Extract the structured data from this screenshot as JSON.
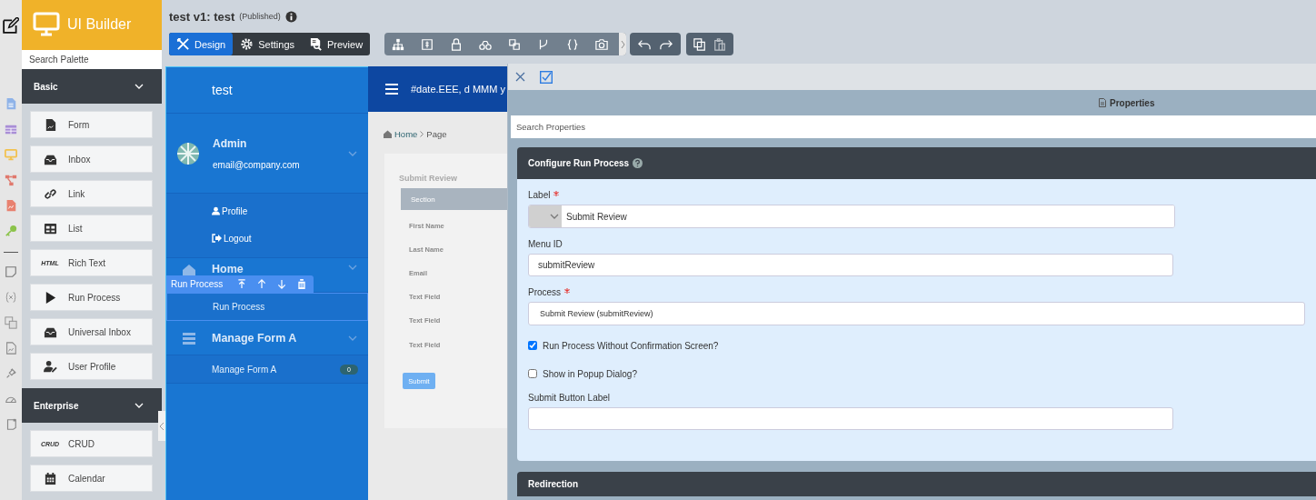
{
  "app": {
    "title": "UI Builder"
  },
  "palette": {
    "search_placeholder": "Search Palette",
    "groups": [
      {
        "name": "Basic",
        "expanded": true,
        "items": [
          {
            "label": "Form"
          },
          {
            "label": "Inbox"
          },
          {
            "label": "Link"
          },
          {
            "label": "List"
          },
          {
            "icon_text": "HTML",
            "label": "Rich Text"
          },
          {
            "label": "Run Process"
          },
          {
            "label": "Universal Inbox"
          },
          {
            "label": "User Profile"
          }
        ]
      },
      {
        "name": "Enterprise",
        "expanded": true,
        "items": [
          {
            "icon_text": "CRUD",
            "label": "CRUD"
          },
          {
            "label": "Calendar"
          }
        ]
      }
    ]
  },
  "header": {
    "title": "test v1: test",
    "status": "(Published)",
    "tabs": [
      {
        "label": "Design",
        "selected": true
      },
      {
        "label": "Settings",
        "selected": false
      },
      {
        "label": "Preview",
        "selected": false
      }
    ]
  },
  "preview": {
    "app_name": "test",
    "user": {
      "name": "Admin",
      "email": "email@company.com"
    },
    "user_links": [
      "Profile",
      "Logout"
    ],
    "menu": [
      {
        "label": "Home",
        "expanded": true,
        "children": [
          {
            "label": "Run Process",
            "selected": true
          }
        ]
      },
      {
        "label": "Manage Form A",
        "expanded": true,
        "children": [
          {
            "label": "Manage Form A",
            "selected": false,
            "badge": "0"
          }
        ]
      }
    ],
    "element_toolbar": {
      "label": "Run Process"
    },
    "topbar_text": "#date.EEE, d MMM y",
    "breadcrumb": [
      "Home",
      "Page"
    ],
    "form": {
      "title": "Submit Review",
      "section": "Section",
      "fields": [
        "First Name",
        "Last Name",
        "Email",
        "Text Field",
        "Text Field",
        "Text Field"
      ],
      "submit": "Submit"
    }
  },
  "properties": {
    "title": "Properties",
    "search_placeholder": "Search Properties",
    "section": "Configure Run Process",
    "fields": [
      {
        "kind": "select_text",
        "label": "Label",
        "required": true,
        "value": "Submit Review"
      },
      {
        "kind": "text",
        "label": "Menu ID",
        "required": false,
        "value": "submitReview"
      },
      {
        "kind": "select",
        "label": "Process",
        "required": true,
        "value": "Submit Review (submitReview)"
      },
      {
        "kind": "checkbox",
        "label": "Run Process Without Confirmation Screen?",
        "checked": true
      },
      {
        "kind": "checkbox",
        "label": "Show in Popup Dialog?",
        "checked": false
      },
      {
        "kind": "text",
        "label": "Submit Button Label",
        "required": false
      }
    ],
    "next_section": "Redirection"
  }
}
